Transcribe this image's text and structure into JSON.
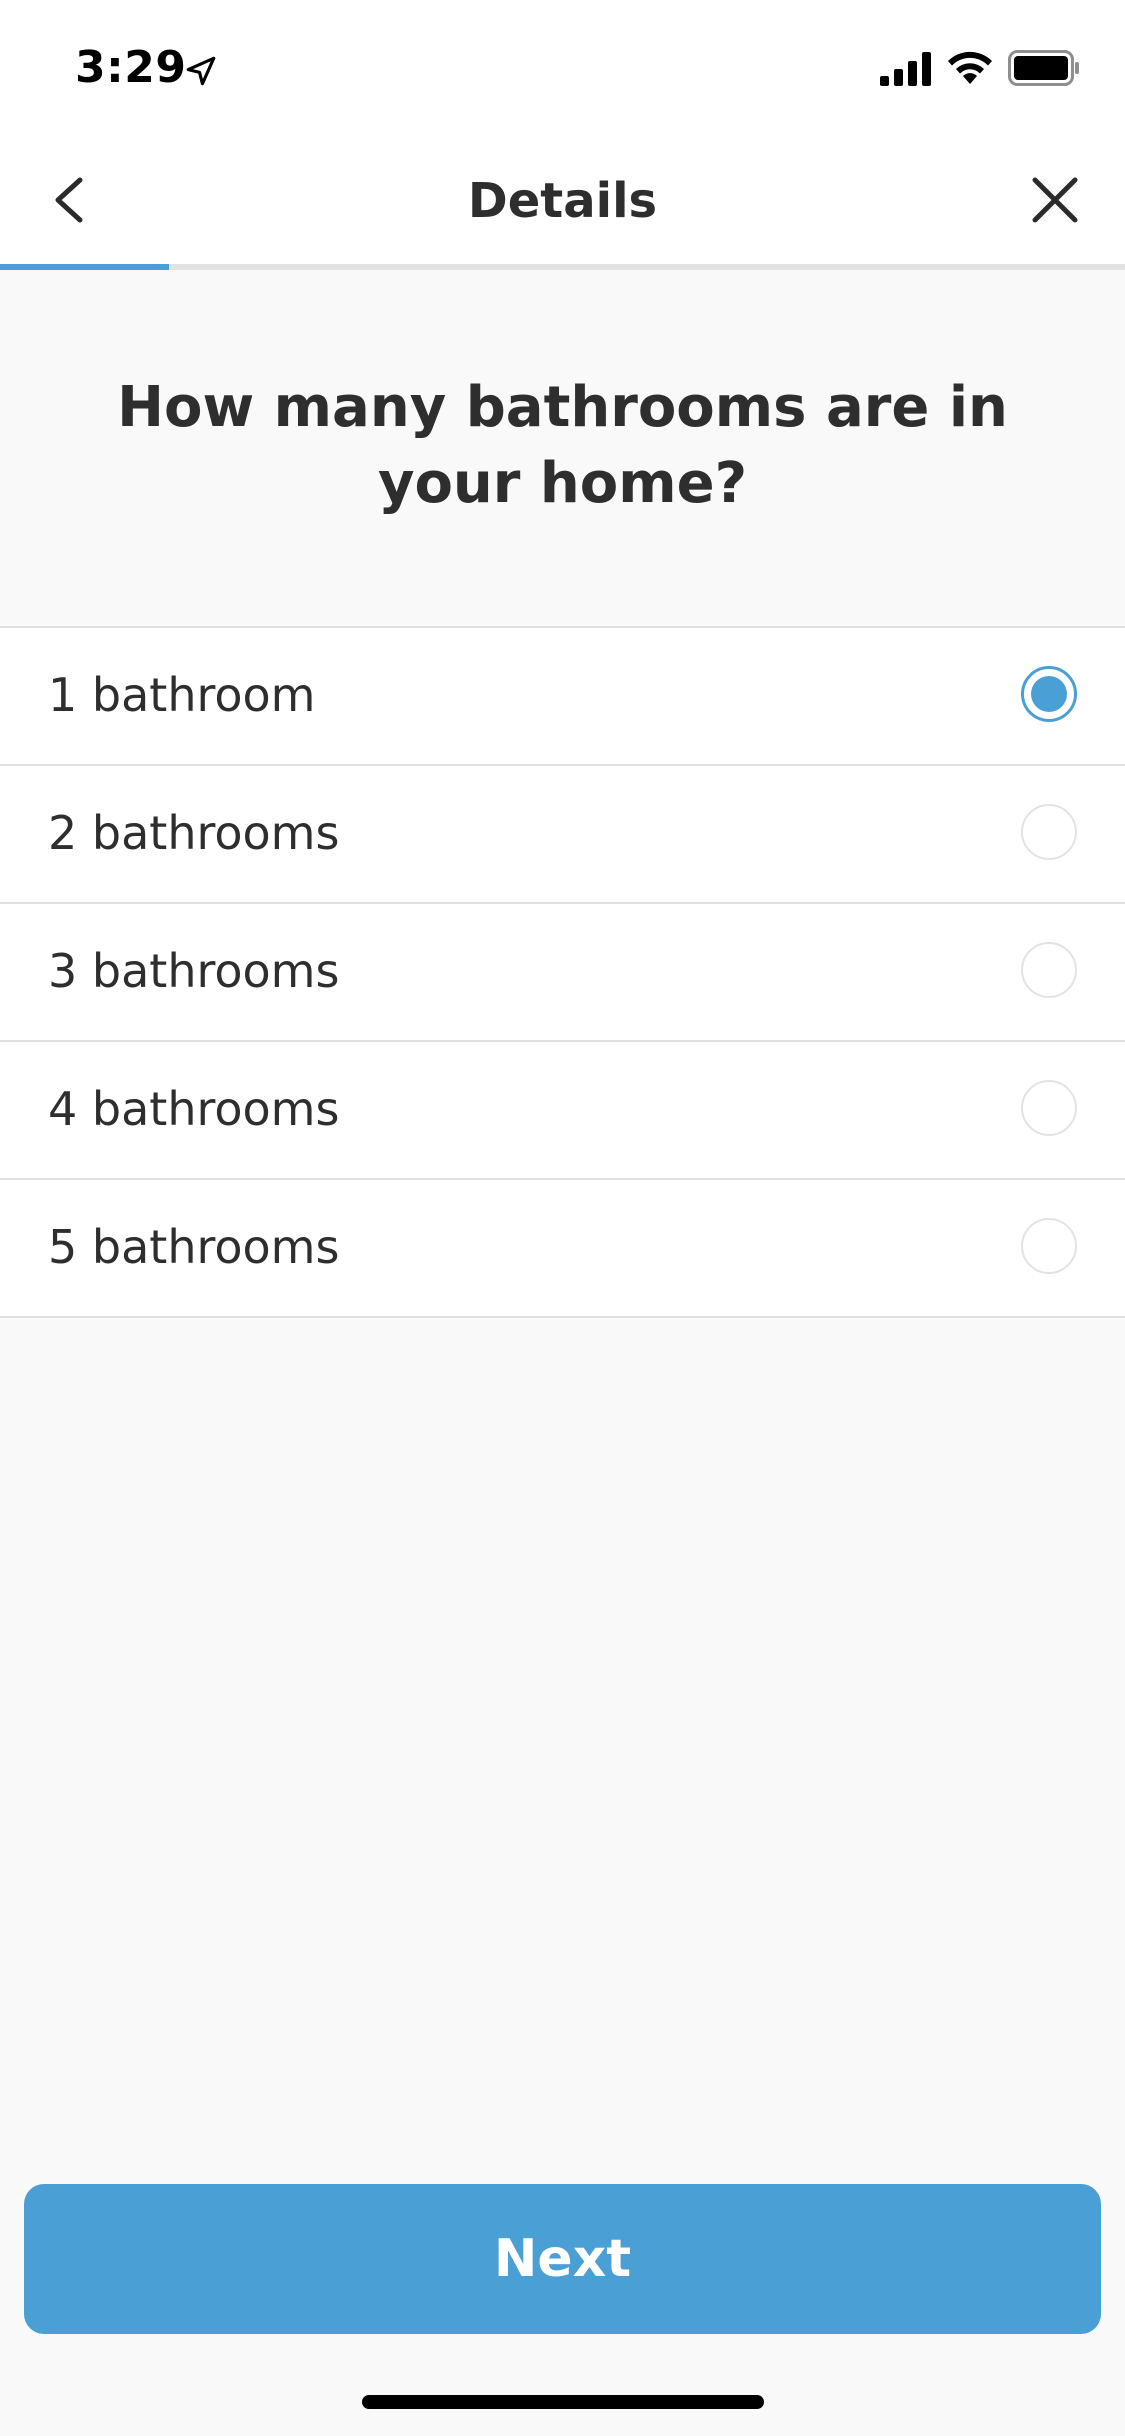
{
  "status_bar": {
    "time": "3:29",
    "icons": [
      "location-arrow-icon",
      "cellular-signal-icon",
      "wifi-icon",
      "battery-icon"
    ]
  },
  "nav": {
    "title": "Details",
    "back_icon": "chevron-left-icon",
    "close_icon": "close-icon",
    "progress_fraction": 0.15
  },
  "question": "How many bathrooms are in your home?",
  "options": [
    {
      "label": "1 bathroom",
      "selected": true
    },
    {
      "label": "2 bathrooms",
      "selected": false
    },
    {
      "label": "3 bathrooms",
      "selected": false
    },
    {
      "label": "4 bathrooms",
      "selected": false
    },
    {
      "label": "5 bathrooms",
      "selected": false
    }
  ],
  "next_label": "Next",
  "colors": {
    "accent": "#4a9fd5",
    "background": "#f9f9f9",
    "text": "#2e2e2e"
  }
}
